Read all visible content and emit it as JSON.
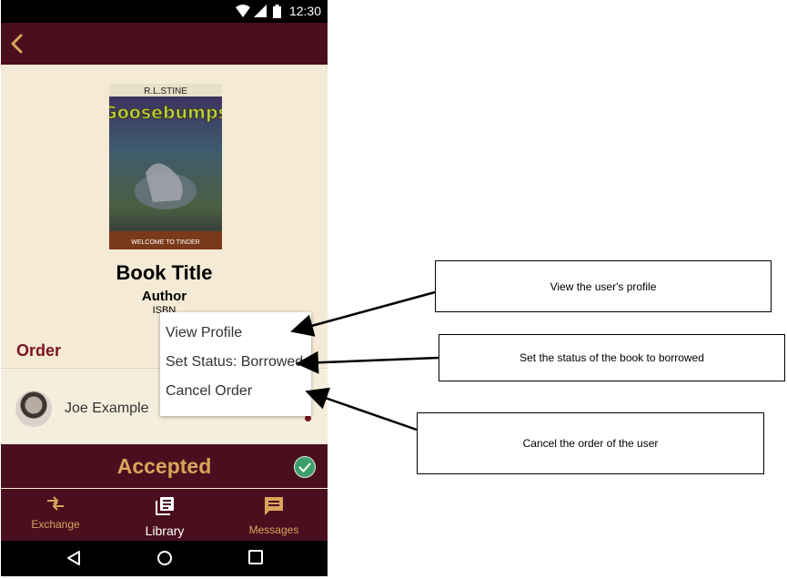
{
  "status_bar": {
    "time": "12:30"
  },
  "book": {
    "cover": {
      "author_text": "R.L.STINE",
      "series_text": "Goosebumps",
      "subtitle_text": "WELCOME TO TINDER"
    },
    "title": "Book Title",
    "author": "Author",
    "isbn": "ISBN"
  },
  "order": {
    "heading": "Order",
    "user_name": "Joe Example",
    "status": "Accepted"
  },
  "context_menu": {
    "items": [
      "View Profile",
      "Set Status: Borrowed",
      "Cancel Order"
    ]
  },
  "bottom_nav": {
    "items": [
      "Exchange",
      "Library",
      "Messages"
    ]
  },
  "annotations": {
    "view_profile": "View the user's profile",
    "set_status": "Set the status of the book to borrowed",
    "cancel_order": "Cancel the order of the user"
  },
  "colors": {
    "primary": "#4a0f1f",
    "accent": "#d9a55a",
    "background": "#f4ead5",
    "heading_red": "#7a1420",
    "success": "#3da06b"
  },
  "icons": [
    "back-arrow-icon",
    "wifi-icon",
    "signal-icon",
    "battery-icon",
    "exchange-icon",
    "library-icon",
    "messages-icon",
    "check-icon",
    "nav-back-icon",
    "nav-home-icon",
    "nav-recents-icon"
  ]
}
